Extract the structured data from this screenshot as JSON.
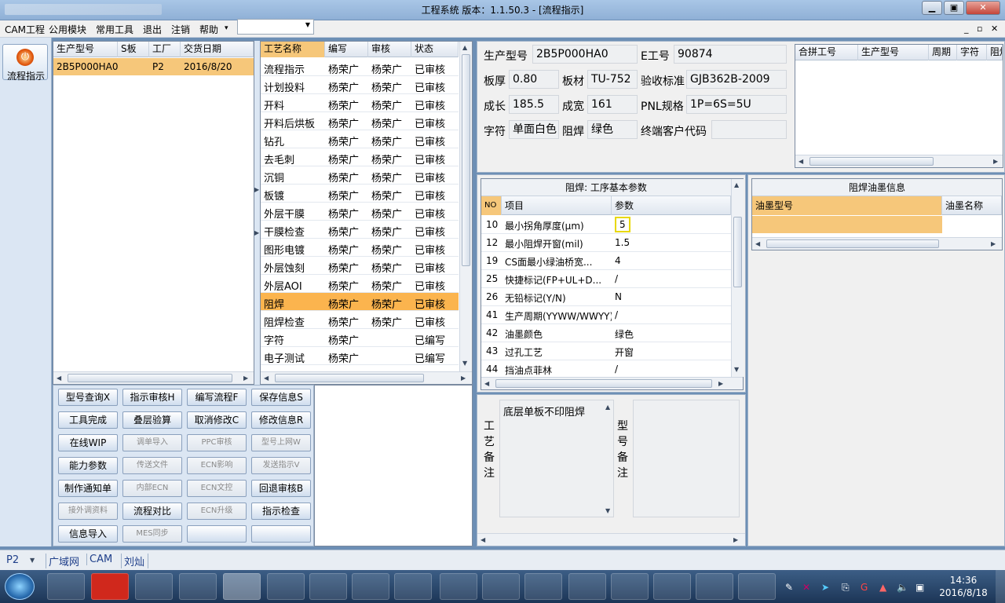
{
  "title": "工程系统   版本：1.1.50.3 - [流程指示]",
  "menu": [
    "CAM工程",
    "公用模块",
    "常用工具",
    "退出",
    "注销",
    "帮助"
  ],
  "help_arrow": "▾",
  "left": {
    "flow_button": "流程指示"
  },
  "order_table": {
    "headers": [
      "生产型号",
      "S板",
      "工厂",
      "交货日期"
    ],
    "rows": [
      [
        "2B5P000HA0",
        "",
        "P2",
        "2016/8/20"
      ]
    ]
  },
  "process_table": {
    "headers": [
      "工艺名称",
      "编写",
      "审核",
      "状态"
    ],
    "rows": [
      [
        "流程指示",
        "杨荣广",
        "杨荣广",
        "已审核"
      ],
      [
        "计划投料",
        "杨荣广",
        "杨荣广",
        "已审核"
      ],
      [
        "开料",
        "杨荣广",
        "杨荣广",
        "已审核"
      ],
      [
        "开料后烘板",
        "杨荣广",
        "杨荣广",
        "已审核"
      ],
      [
        "钻孔",
        "杨荣广",
        "杨荣广",
        "已审核"
      ],
      [
        "去毛刺",
        "杨荣广",
        "杨荣广",
        "已审核"
      ],
      [
        "沉铜",
        "杨荣广",
        "杨荣广",
        "已审核"
      ],
      [
        "板镀",
        "杨荣广",
        "杨荣广",
        "已审核"
      ],
      [
        "外层干膜",
        "杨荣广",
        "杨荣广",
        "已审核"
      ],
      [
        "干膜检查",
        "杨荣广",
        "杨荣广",
        "已审核"
      ],
      [
        "图形电镀",
        "杨荣广",
        "杨荣广",
        "已审核"
      ],
      [
        "外层蚀刻",
        "杨荣广",
        "杨荣广",
        "已审核"
      ],
      [
        "外层AOI",
        "杨荣广",
        "杨荣广",
        "已审核"
      ],
      [
        "阻焊",
        "杨荣广",
        "杨荣广",
        "已审核"
      ],
      [
        "阻焊检查",
        "杨荣广",
        "杨荣广",
        "已审核"
      ],
      [
        "字符",
        "杨荣广",
        "",
        "已编写"
      ],
      [
        "电子测试",
        "杨荣广",
        "",
        "已编写"
      ]
    ],
    "selected_index": 13
  },
  "buttons": [
    [
      "型号查询X",
      "指示审核H",
      "编写流程F",
      "保存信息S"
    ],
    [
      "工具完成",
      "叠层验算",
      "取消修改C",
      "修改信息R"
    ],
    [
      "在线WIP",
      "调单导入",
      "PPC审核",
      "型号上网W"
    ],
    [
      "能力参数",
      "传送文件",
      "ECN影响",
      "发送指示V"
    ],
    [
      "制作通知单",
      "内部ECN",
      "ECN文控",
      "回退审核B"
    ],
    [
      "接外调资料",
      "流程对比",
      "ECN升级",
      "指示检查"
    ],
    [
      "信息导入",
      "MES同步",
      "",
      ""
    ]
  ],
  "disabled_buttons": [
    "调单导入",
    "PPC审核",
    "型号上网W",
    "传送文件",
    "ECN影响",
    "发送指示V",
    "内部ECN",
    "ECN文控",
    "接外调资料",
    "ECN升级",
    "MES同步"
  ],
  "info": {
    "model_label": "生产型号",
    "model": "2B5P000HA0",
    "eno_label": "E工号",
    "eno": "90874",
    "thick_label": "板厚",
    "thick": "0.80",
    "material_label": "板材",
    "material": "TU-752",
    "standard_label": "验收标准",
    "standard": "GJB362B-2009",
    "length_label": "成长",
    "length": "185.5",
    "width_label": "成宽",
    "width": "161",
    "pnl_label": "PNL规格",
    "pnl": "1P=6S=5U",
    "char_label": "字符",
    "char": "单面白色",
    "mask_label": "阻焊",
    "mask": "绿色",
    "customer_label": "终端客户代码",
    "customer": ""
  },
  "merge_table": {
    "headers": [
      "合拼工号",
      "生产型号",
      "周期",
      "字符",
      "阻焊"
    ]
  },
  "param_table": {
    "title": "阻焊: 工序基本参数",
    "headers": [
      "NO",
      "项目",
      "参数"
    ],
    "rows": [
      [
        "10",
        "最小拐角厚度(μm)",
        "5"
      ],
      [
        "12",
        "最小阻焊开窗(mil)",
        "1.5"
      ],
      [
        "19",
        "CS面最小绿油桥宽...",
        "4"
      ],
      [
        "25",
        "快捷标记(FP+UL+D...",
        "/"
      ],
      [
        "26",
        "无铅标记(Y/N)",
        "N"
      ],
      [
        "41",
        "生产周期(YYWW/WWYY)",
        "/"
      ],
      [
        "42",
        "油墨颜色",
        "绿色"
      ],
      [
        "43",
        "过孔工艺",
        "开窗"
      ],
      [
        "44",
        "挡油点菲林",
        "/"
      ]
    ]
  },
  "ink_table": {
    "title": "阻焊油墨信息",
    "headers": [
      "油墨型号",
      "油墨名称"
    ]
  },
  "notes": {
    "process_label": "工艺备注",
    "process_note": "底层单板不印阻焊",
    "model_label": "型号备注",
    "model_note": ""
  },
  "status": {
    "plant": "P2",
    "items": [
      "广域网",
      "CAM",
      "刘灿"
    ]
  },
  "clock": {
    "time": "14:36",
    "date": "2016/8/18"
  },
  "colors": {
    "selected_row": "#fbb44e",
    "accent": "#f6c77a"
  }
}
